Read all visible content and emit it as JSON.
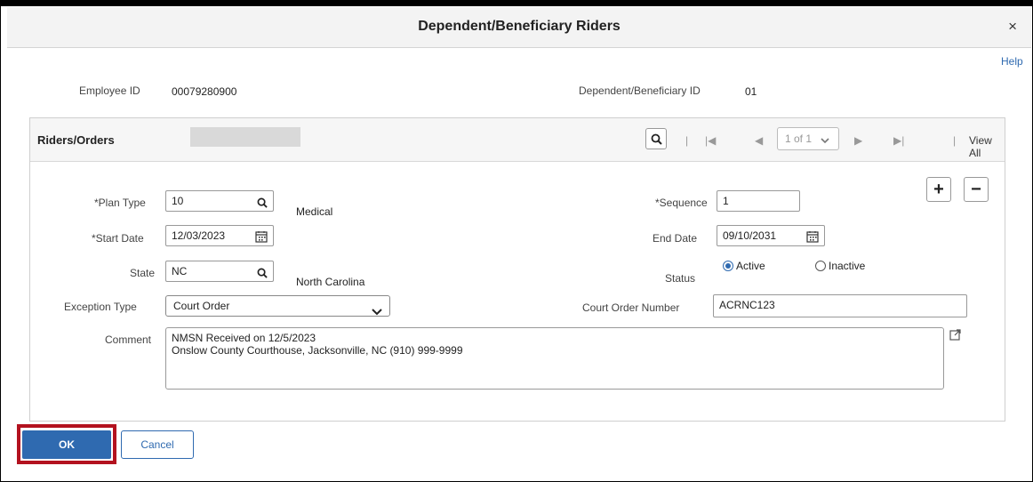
{
  "dialog": {
    "title": "Dependent/Beneficiary Riders",
    "close_glyph": "×",
    "help": "Help"
  },
  "header": {
    "employee_id_label": "Employee ID",
    "employee_id": "00079280900",
    "dep_id_label": "Dependent/Beneficiary ID",
    "dep_id": "01"
  },
  "panel": {
    "title": "Riders/Orders",
    "pager": {
      "first": "|◀",
      "prev": "◀",
      "page": "1 of 1",
      "next": "▶",
      "last": "▶|",
      "view_all": "View All",
      "sep": "|"
    },
    "add": "+",
    "remove": "−"
  },
  "form": {
    "plan_type_label": "*Plan Type",
    "plan_type": "10",
    "plan_type_desc": "Medical",
    "start_date_label": "*Start Date",
    "start_date": "12/03/2023",
    "state_label": "State",
    "state": "NC",
    "state_desc": "North Carolina",
    "exception_type_label": "Exception Type",
    "exception_type": "Court Order",
    "comment_label": "Comment",
    "comment": "NMSN Received on 12/5/2023\nOnslow County Courthouse, Jacksonville, NC (910) 999-9999",
    "sequence_label": "*Sequence",
    "sequence": "1",
    "end_date_label": "End Date",
    "end_date": "09/10/2031",
    "status_label": "Status",
    "status_active": "Active",
    "status_inactive": "Inactive",
    "court_order_label": "Court Order Number",
    "court_order": "ACRNC123"
  },
  "buttons": {
    "ok": "OK",
    "cancel": "Cancel"
  },
  "colors": {
    "accent": "#2f6ab0",
    "highlight": "#b3121f"
  }
}
